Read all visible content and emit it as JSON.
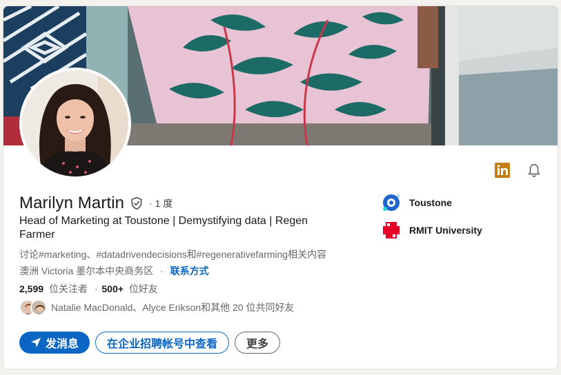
{
  "profile": {
    "name": "Marilyn Martin",
    "degree": "· 1 度",
    "headline": "Head of Marketing at Toustone | Demystifying data | Regen Farmer",
    "topics": "讨论#marketing、#datadrivendecisions和#regenerativefarming相关内容",
    "location": "澳洲 Victoria 墨尔本中央商务区",
    "location_sep": "·",
    "contact_label": "联系方式",
    "followers_count": "2,599",
    "followers_label": "位关注者",
    "stats_sep": "·",
    "connections_count": "500+",
    "connections_label": "位好友",
    "mutual_text": "Natalie MacDonald、Alyce Erikson和其他 20 位共同好友"
  },
  "actions": {
    "message": "发消息",
    "recruiter": "在企业招聘帐号中查看",
    "more": "更多"
  },
  "organizations": [
    {
      "name": "Toustone",
      "logo": "toustone-logo"
    },
    {
      "name": "RMIT University",
      "logo": "rmit-logo"
    }
  ],
  "icons": {
    "top_right": [
      "linkedin-icon",
      "bell-icon"
    ],
    "verified": "verified-shield-icon",
    "message": "paper-plane-icon"
  },
  "colors": {
    "primary": "#0a66c2",
    "linkedin_icon": "#c37d16",
    "rmit_red": "#e60028"
  }
}
